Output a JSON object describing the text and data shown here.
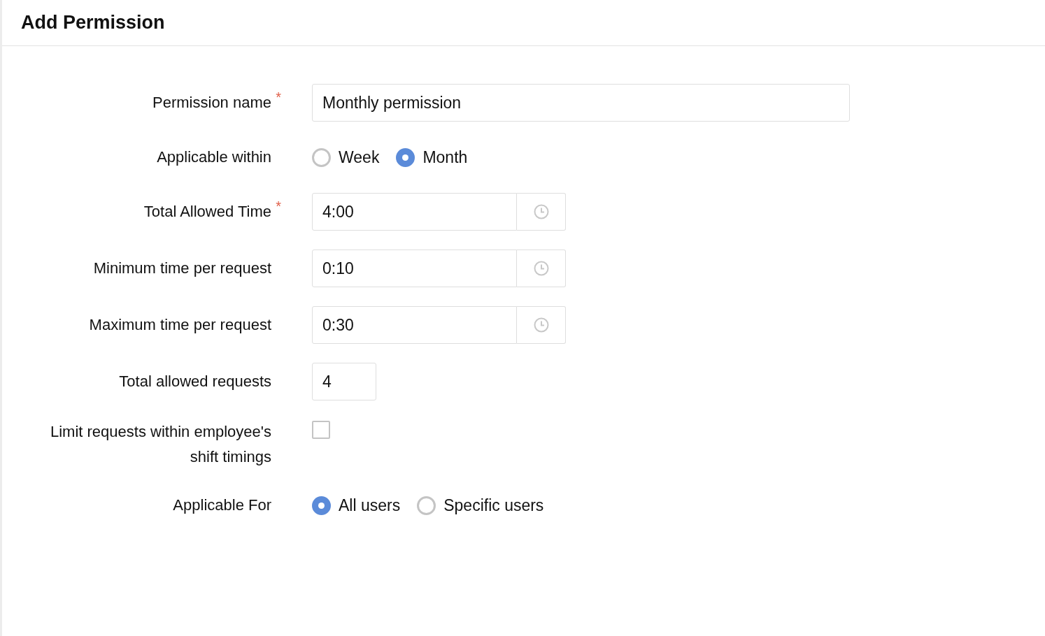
{
  "title": "Add Permission",
  "fields": [
    {
      "kind": "text",
      "label": "Permission name",
      "required_mark": "*",
      "value": "Monthly permission"
    },
    {
      "kind": "radio",
      "label": "Applicable within",
      "options": [
        {
          "label": "Week",
          "selected": false
        },
        {
          "label": "Month",
          "selected": true
        }
      ]
    },
    {
      "kind": "time",
      "label": "Total Allowed Time",
      "required_mark": "*",
      "value": "4:00"
    },
    {
      "kind": "time",
      "label": "Minimum time per request",
      "value": "0:10"
    },
    {
      "kind": "time",
      "label": "Maximum time per request",
      "value": "0:30"
    },
    {
      "kind": "number",
      "label": "Total allowed requests",
      "value": "4"
    },
    {
      "kind": "checkbox",
      "label": "Limit requests within employee's shift timings",
      "checked": false
    },
    {
      "kind": "radio",
      "label": "Applicable For",
      "options": [
        {
          "label": "All users",
          "selected": true
        },
        {
          "label": "Specific users",
          "selected": false
        }
      ]
    }
  ]
}
